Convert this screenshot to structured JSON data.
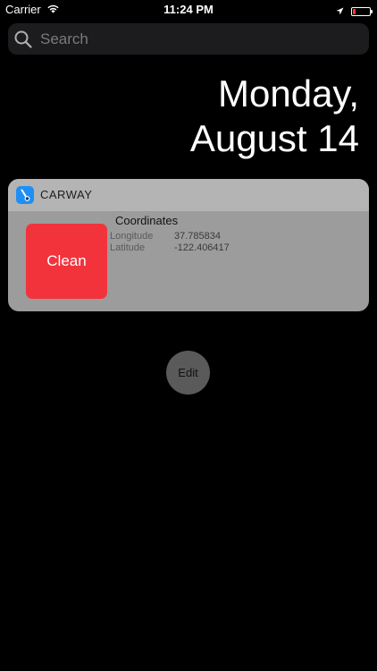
{
  "status_bar": {
    "carrier": "Carrier",
    "time": "11:24 PM",
    "battery_level": 0.15,
    "battery_color": "#ff3b30"
  },
  "search": {
    "placeholder": "Search",
    "value": ""
  },
  "date": {
    "line1": "Monday,",
    "line2": "August 14"
  },
  "widget": {
    "app_name": "CARWAY",
    "app_icon": "carway-app-icon",
    "clean_label": "Clean",
    "clean_color": "#f2333b",
    "coordinates_title": "Coordinates",
    "longitude_label": "Longitude",
    "longitude_value": "37.785834",
    "latitude_label": "Latitude",
    "latitude_value": "-122.406417"
  },
  "edit_label": "Edit",
  "icons": {
    "wifi": "wifi-icon",
    "location": "location-arrow-icon",
    "battery": "battery-icon",
    "search": "search-icon"
  }
}
